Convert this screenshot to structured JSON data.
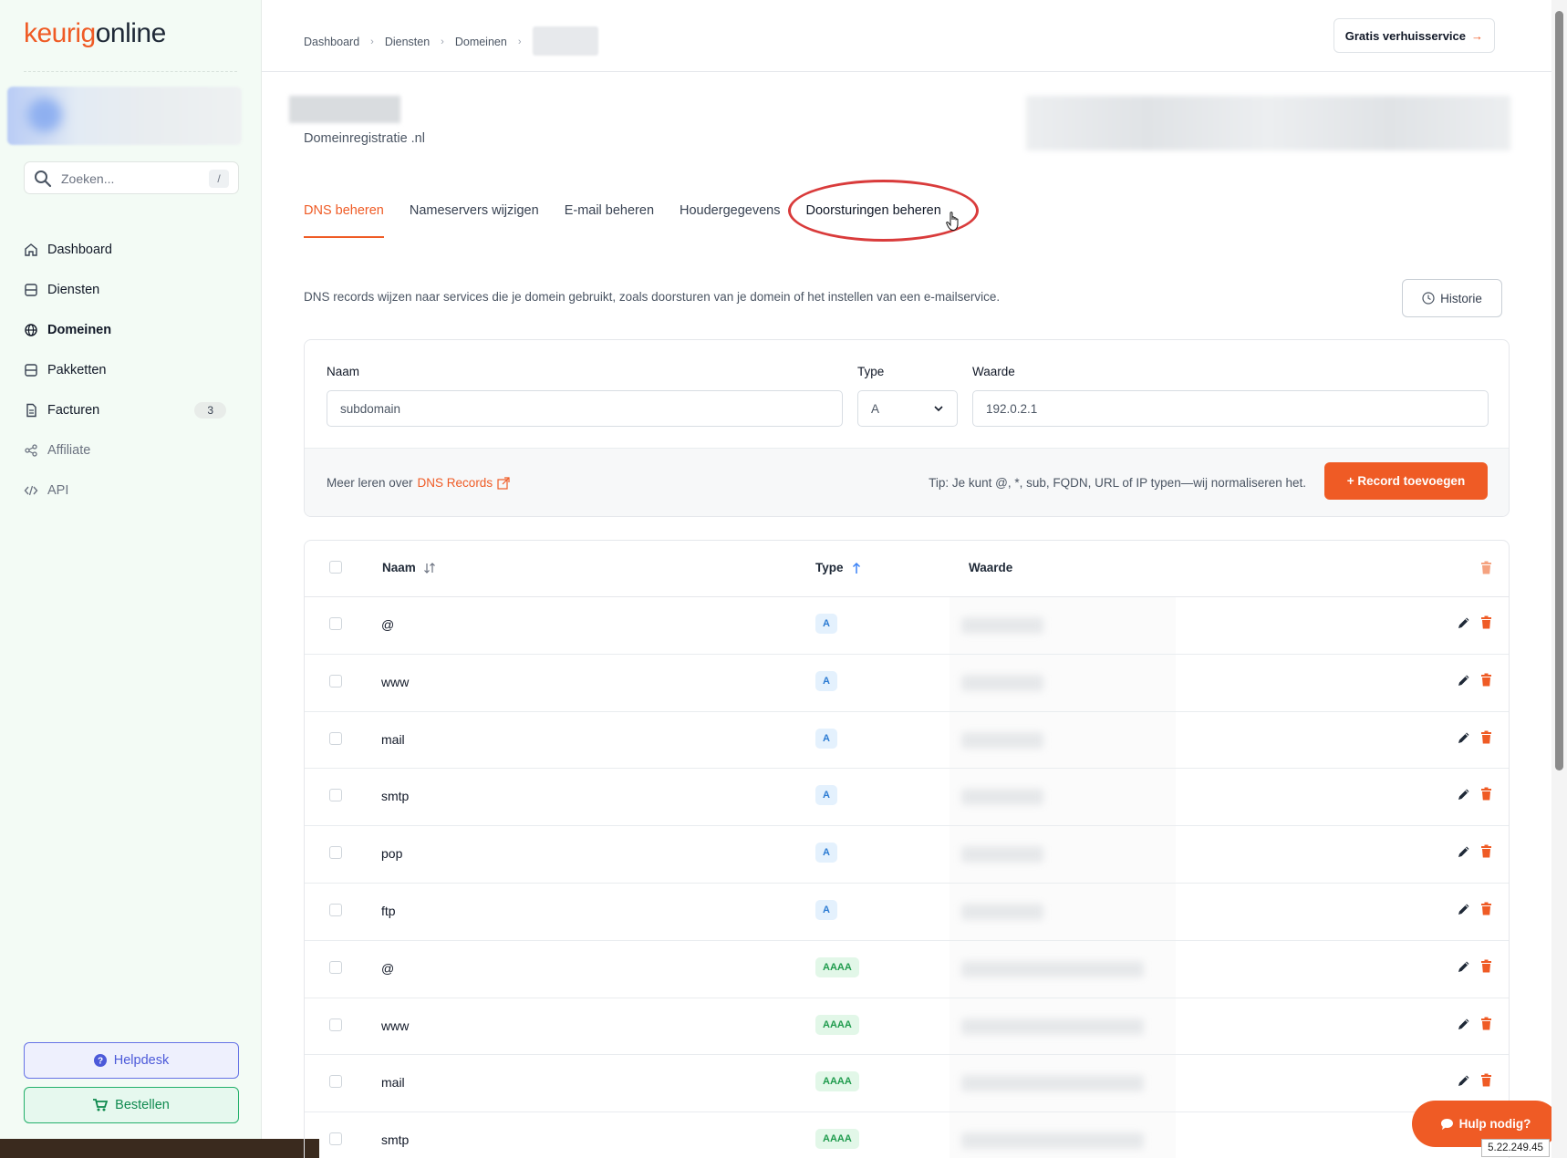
{
  "brand": {
    "part1": "keurig",
    "part2": "online"
  },
  "search": {
    "placeholder": "Zoeken...",
    "shortcut": "/"
  },
  "sidebar": {
    "items": [
      {
        "label": "Dashboard",
        "icon": "home-icon"
      },
      {
        "label": "Diensten",
        "icon": "server-icon"
      },
      {
        "label": "Domeinen",
        "icon": "globe-icon"
      },
      {
        "label": "Pakketten",
        "icon": "server-icon"
      },
      {
        "label": "Facturen",
        "icon": "document-icon",
        "badge": "3"
      },
      {
        "label": "Affiliate",
        "icon": "share-icon"
      },
      {
        "label": "API",
        "icon": "code-icon"
      }
    ],
    "helpdesk": "Helpdesk",
    "bestellen": "Bestellen"
  },
  "breadcrumb": [
    "Dashboard",
    "Diensten",
    "Domeinen"
  ],
  "header": {
    "move_button": "Gratis verhuisservice"
  },
  "domain": {
    "subtitle": "Domeinregistratie .nl"
  },
  "tabs": [
    "DNS beheren",
    "Nameservers wijzigen",
    "E-mail beheren",
    "Houdergegevens",
    "Doorsturingen beheren"
  ],
  "description": "DNS records wijzen naar services die je domein gebruikt, zoals doorsturen van je domein of het instellen van een e-mailservice.",
  "historie": "Historie",
  "form": {
    "naam_label": "Naam",
    "naam_value": "subdomain",
    "type_label": "Type",
    "type_value": "A",
    "waarde_label": "Waarde",
    "waarde_value": "192.0.2.1",
    "learn_prefix": "Meer leren over",
    "learn_link": "DNS Records",
    "tip": "Tip: Je kunt @, *, sub, FQDN, URL of IP typen—wij normaliseren het.",
    "add_button": "+ Record toevoegen"
  },
  "table": {
    "headers": {
      "naam": "Naam",
      "type": "Type",
      "waarde": "Waarde"
    },
    "rows": [
      {
        "naam": "@",
        "type": "A"
      },
      {
        "naam": "www",
        "type": "A"
      },
      {
        "naam": "mail",
        "type": "A"
      },
      {
        "naam": "smtp",
        "type": "A"
      },
      {
        "naam": "pop",
        "type": "A"
      },
      {
        "naam": "ftp",
        "type": "A"
      },
      {
        "naam": "@",
        "type": "AAAA"
      },
      {
        "naam": "www",
        "type": "AAAA"
      },
      {
        "naam": "mail",
        "type": "AAAA"
      },
      {
        "naam": "smtp",
        "type": "AAAA"
      }
    ]
  },
  "help_fab": "Hulp nodig?",
  "ip_badge": "5.22.249.45",
  "colors": {
    "accent": "#ef5b25",
    "type_a": "#2b7bd3",
    "type_aaaa": "#1f9b4d",
    "annotation": "#d93b3b"
  }
}
